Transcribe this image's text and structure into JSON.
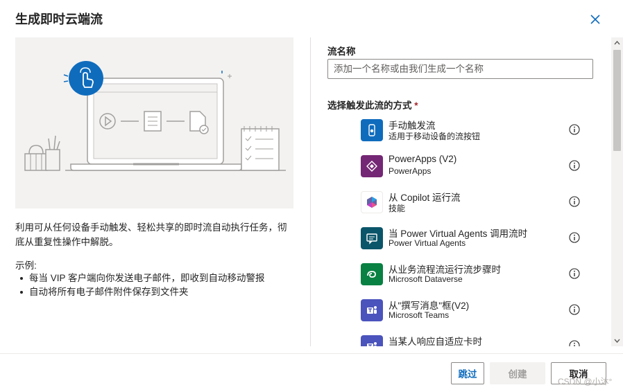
{
  "dialog": {
    "title": "生成即时云端流"
  },
  "left": {
    "description": "利用可从任何设备手动触发、轻松共享的即时流自动执行任务，彻底从重复性操作中解脱。",
    "examples_title": "示例:",
    "examples": [
      "每当 VIP 客户端向你发送电子邮件，即收到自动移动警报",
      "自动将所有电子邮件附件保存到文件夹"
    ]
  },
  "form": {
    "flow_name_label": "流名称",
    "flow_name_placeholder": "添加一个名称或由我们生成一个名称",
    "flow_name_value": "",
    "trigger_label": "选择触发此流的方式",
    "required_mark": "*"
  },
  "triggers": [
    {
      "name": "手动触发流",
      "subtitle": "适用于移动设备的流按钮",
      "icon": "touch-button-icon",
      "color": "#0f6cbd"
    },
    {
      "name": "PowerApps (V2)",
      "subtitle": "PowerApps",
      "icon": "powerapps-icon",
      "color": "#742774"
    },
    {
      "name": "从 Copilot 运行流",
      "subtitle": "技能",
      "icon": "copilot-icon",
      "color": "#ffffff"
    },
    {
      "name": "当 Power Virtual Agents 调用流时",
      "subtitle": "Power Virtual Agents",
      "icon": "power-virtual-agents-icon",
      "color": "#0b556a"
    },
    {
      "name": "从业务流程流运行流步骤时",
      "subtitle": "Microsoft Dataverse",
      "icon": "dataverse-icon",
      "color": "#088142"
    },
    {
      "name": "从\"撰写消息\"框(V2)",
      "subtitle": "Microsoft Teams",
      "icon": "teams-icon",
      "color": "#4b53bc"
    },
    {
      "name": "当某人响应自适应卡时",
      "subtitle": "",
      "icon": "teams-icon",
      "color": "#4b53bc"
    }
  ],
  "buttons": {
    "skip": "跳过",
    "create": "创建",
    "cancel": "取消"
  },
  "watermark": "CSDN @小沐°",
  "colors": {
    "accent": "#0f6cbd",
    "illustration_bg": "#f3f2f1"
  }
}
